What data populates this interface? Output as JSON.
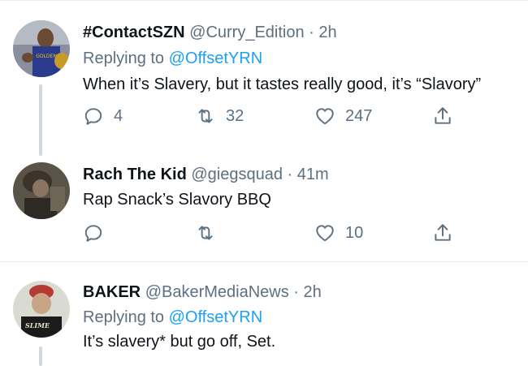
{
  "tweets": [
    {
      "display_name": "#ContactSZN",
      "handle": "@Curry_Edition",
      "time": "2h",
      "replying_prefix": "Replying to",
      "replying_to": "@OffsetYRN",
      "text": "When it’s Slavery, but it tastes really good, it’s “Slavory”",
      "replies": "4",
      "retweets": "32",
      "likes": "247"
    },
    {
      "display_name": "Rach The Kid",
      "handle": "@giegsquad",
      "time": "41m",
      "text": "Rap Snack’s Slavory BBQ",
      "replies": "",
      "retweets": "",
      "likes": "10"
    },
    {
      "display_name": "BAKER",
      "handle": "@BakerMediaNews",
      "time": "2h",
      "replying_prefix": "Replying to",
      "replying_to": "@OffsetYRN",
      "text": "It’s slavery* but go off, Set.",
      "avatar_shirt_text": "SLIME"
    }
  ],
  "separator": "·",
  "colors": {
    "accent": "#1da1f2",
    "secondary_text": "#5b7083",
    "divider": "#e6ecf0",
    "thread_line": "#cfd9de"
  }
}
